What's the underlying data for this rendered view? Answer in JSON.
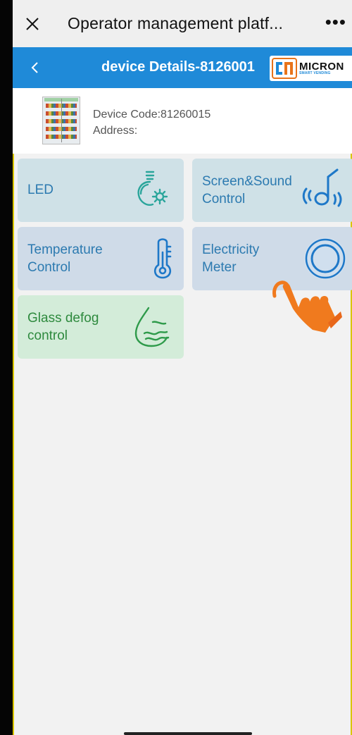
{
  "topbar": {
    "title": "Operator management platf...",
    "more": "•••",
    "close_icon": "close-icon"
  },
  "nav": {
    "title": "device Details-8126001",
    "back_icon": "chevron-left-icon",
    "logo": {
      "brand": "MICRON",
      "sub": "SMART VENDING"
    }
  },
  "device": {
    "code_text": "Device Code:81260015",
    "address_text": "Address:"
  },
  "tiles": [
    {
      "label": "LED",
      "icon": "lightbulb-gear-icon"
    },
    {
      "label": "Screen&Sound\nControl",
      "icon": "music-note-sound-icon"
    },
    {
      "label": "Temperature\nControl",
      "icon": "thermometer-icon"
    },
    {
      "label": "Electricity\nMeter",
      "icon": "meter-dial-icon"
    },
    {
      "label": "Glass defog\ncontrol",
      "icon": "water-drop-waves-icon"
    }
  ],
  "colors": {
    "nav_blue": "#1f8ad8",
    "tile_text_blue": "#2c7ab0",
    "tile_text_green": "#2e8a3e",
    "tile_bg_teal": "#cfe1e7",
    "tile_bg_green": "#d3ecd9",
    "pointer_orange": "#f07a1e"
  }
}
